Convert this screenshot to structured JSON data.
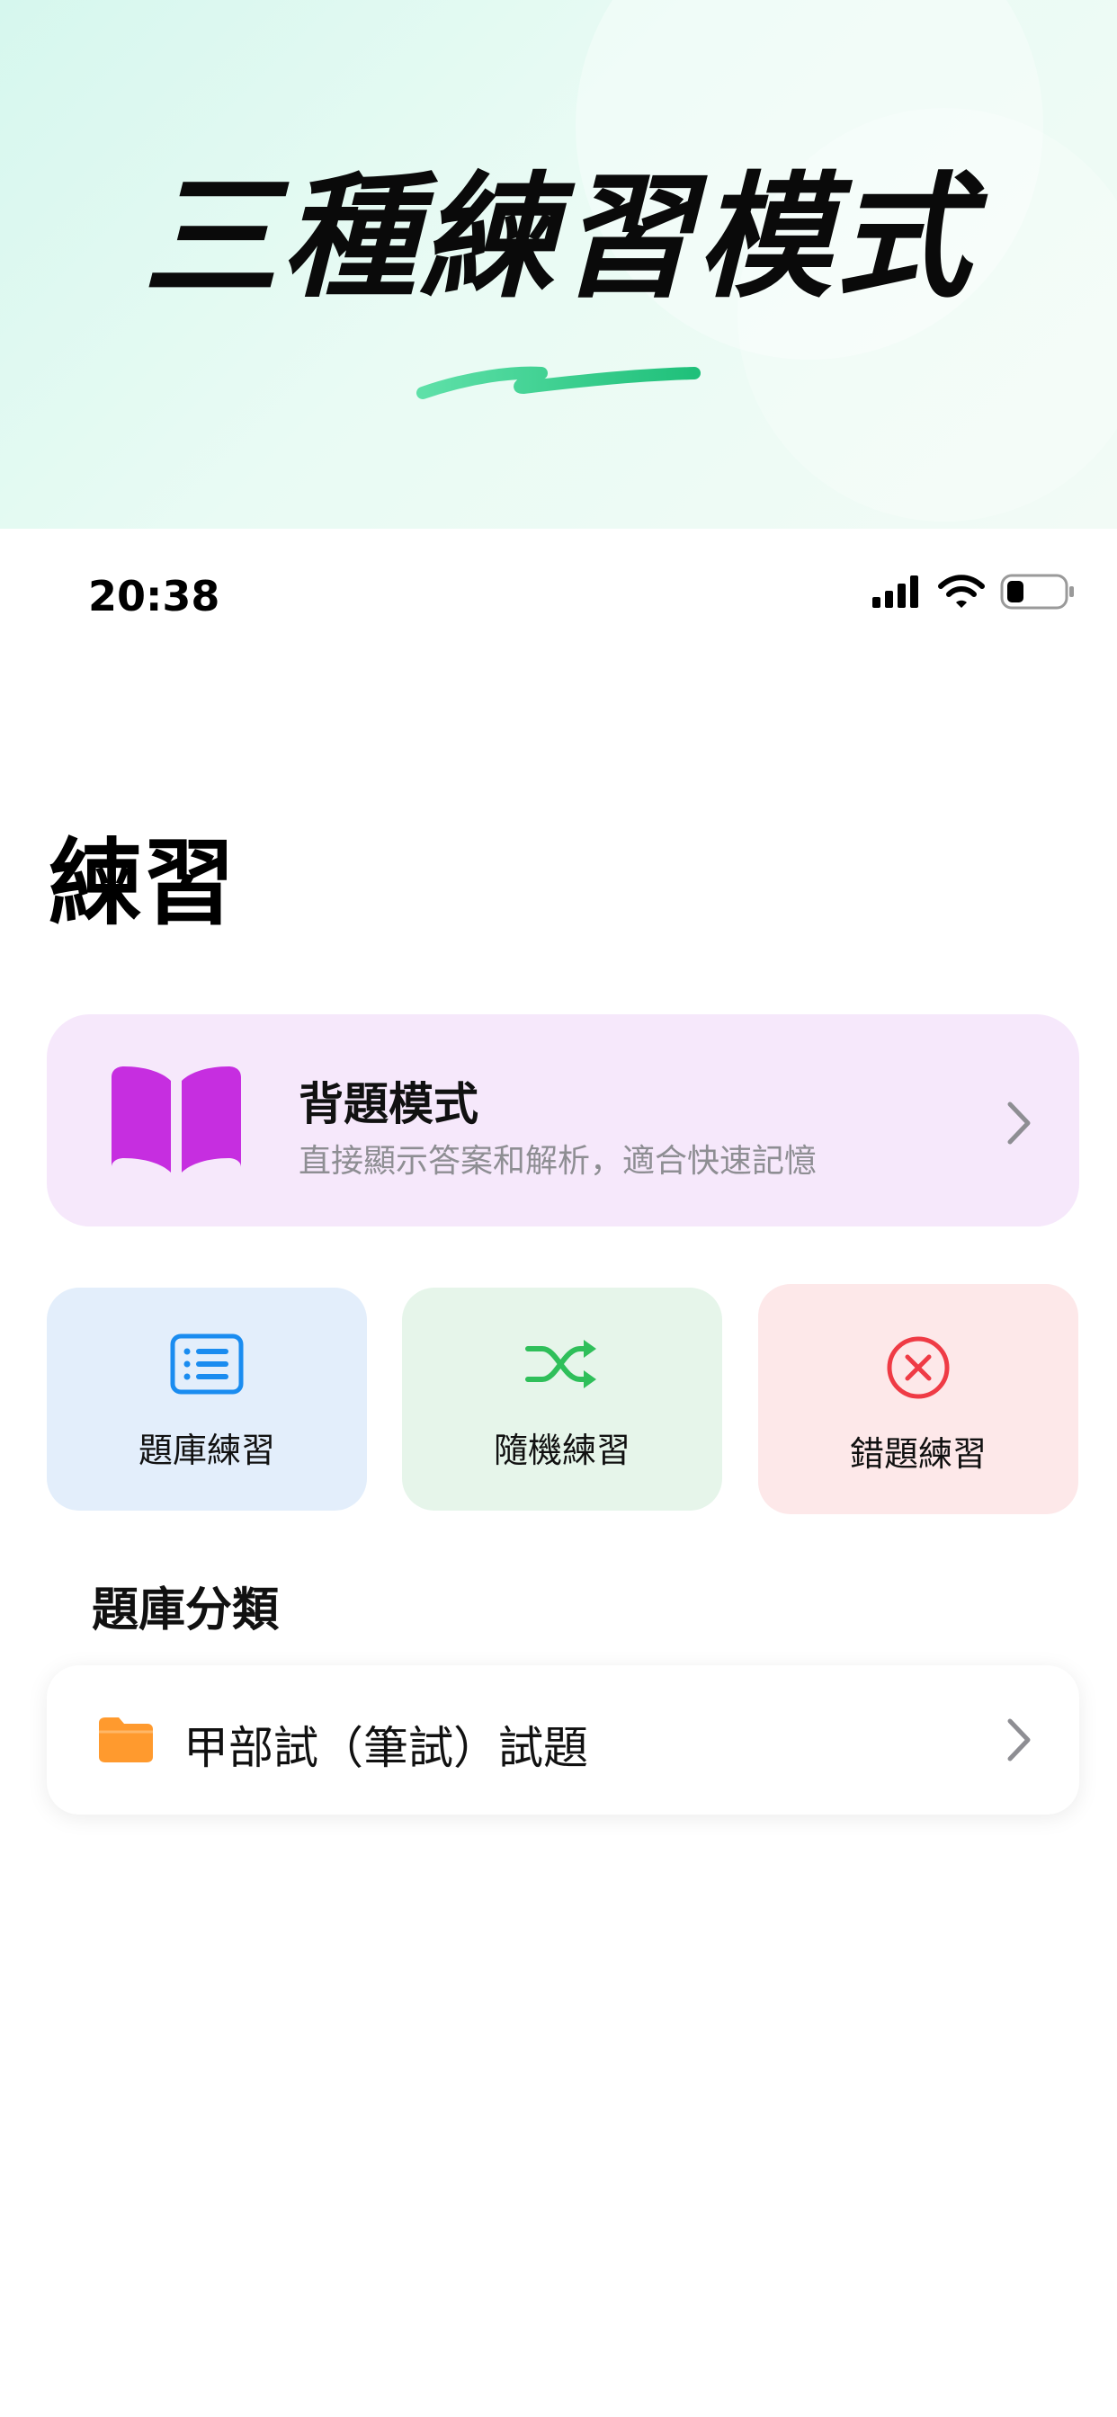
{
  "hero": {
    "title": "三種練習模式"
  },
  "status_bar": {
    "time": "20:38"
  },
  "page": {
    "title": "練習"
  },
  "memorize_card": {
    "title": "背題模式",
    "subtitle": "直接顯示答案和解析，適合快速記憶",
    "icon": "book-open-icon",
    "color": "#c62ee0"
  },
  "modes": [
    {
      "label": "題庫練習",
      "icon": "list-icon",
      "color": "#1a8cf0"
    },
    {
      "label": "隨機練習",
      "icon": "shuffle-icon",
      "color": "#2fbf5a"
    },
    {
      "label": "錯題練習",
      "icon": "x-circle-icon",
      "color": "#ef3b45"
    }
  ],
  "categories": {
    "section_title": "題庫分類",
    "items": [
      {
        "label": "甲部試（筆試）試題",
        "icon": "folder-icon",
        "color": "#ff9a2e"
      }
    ]
  }
}
